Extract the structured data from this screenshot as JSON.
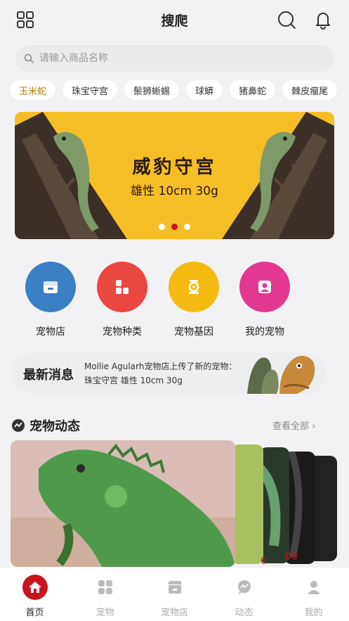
{
  "header": {
    "title": "搜爬",
    "grid_icon": "grid-icon",
    "search_icon": "search-icon",
    "bell_icon": "bell-icon"
  },
  "search": {
    "placeholder": "请输入商品名称"
  },
  "tags": [
    "玉米蛇",
    "珠宝守宫",
    "鬃狮蜥蜴",
    "球蟒",
    "猪鼻蛇",
    "棘皮瘤尾"
  ],
  "banner": {
    "title": "威豹守宫",
    "subtitle": "雄性 10cm 30g",
    "active_dot": 2,
    "dot_count": 3
  },
  "categories": [
    {
      "label": "宠物店",
      "color": "#3b7fc4",
      "icon": "store-icon"
    },
    {
      "label": "宠物种类",
      "color": "#e9473f",
      "icon": "category-icon"
    },
    {
      "label": "宠物基因",
      "color": "#f5bb12",
      "icon": "gene-icon"
    },
    {
      "label": "我的宠物",
      "color": "#e2388f",
      "icon": "user-icon"
    }
  ],
  "news": {
    "title": "最新消息",
    "text": "Mollie Agularh宠物店上传了新的宠物：珠宝守宫 雄性 10cm 30g"
  },
  "feed": {
    "title": "宠物动态",
    "view_all": "查看全部 ›",
    "card_numbers": [
      "0",
      "00"
    ]
  },
  "tabbar": [
    {
      "label": "首页",
      "icon": "home-icon",
      "active": true
    },
    {
      "label": "宠物",
      "icon": "pet-icon",
      "active": false
    },
    {
      "label": "宠物店",
      "icon": "shop-icon",
      "active": false
    },
    {
      "label": "动态",
      "icon": "message-icon",
      "active": false
    },
    {
      "label": "我的",
      "icon": "profile-icon",
      "active": false
    }
  ],
  "colors": {
    "accent": "#c8161e",
    "banner_bg": "#f6be26"
  }
}
